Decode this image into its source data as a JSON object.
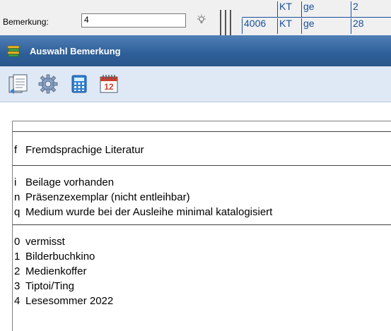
{
  "background": {
    "bemerkung_label": "Bemerkung:",
    "bemerkung_value": "4",
    "grid_cells": [
      "4006",
      "KT",
      "KT",
      "ge",
      "ge",
      "2",
      "28"
    ]
  },
  "dialog": {
    "title": "Auswahl Bemerkung",
    "toolbar": [
      {
        "icon": "document-icon"
      },
      {
        "icon": "gear-icon"
      },
      {
        "icon": "calculator-icon"
      },
      {
        "icon": "calendar-icon",
        "text": "12"
      }
    ],
    "groups": [
      [
        {
          "code": "f",
          "label": "Fremdsprachige Literatur"
        }
      ],
      [
        {
          "code": "i",
          "label": "Beilage vorhanden"
        },
        {
          "code": "n",
          "label": "Präsenzexemplar (nicht entleihbar)"
        },
        {
          "code": "q",
          "label": "Medium wurde bei der Ausleihe minimal katalogisiert"
        }
      ],
      [
        {
          "code": "0",
          "label": "vermisst"
        },
        {
          "code": "1",
          "label": "Bilderbuchkino"
        },
        {
          "code": "2",
          "label": "Medienkoffer"
        },
        {
          "code": "3",
          "label": "Tiptoi/Ting"
        },
        {
          "code": "4",
          "label": "Lesesommer 2022"
        }
      ]
    ]
  },
  "colors": {
    "titlebar": "#2f5f98",
    "toolbar": "#dfe8f5",
    "grid_text": "#1a4f9c"
  }
}
